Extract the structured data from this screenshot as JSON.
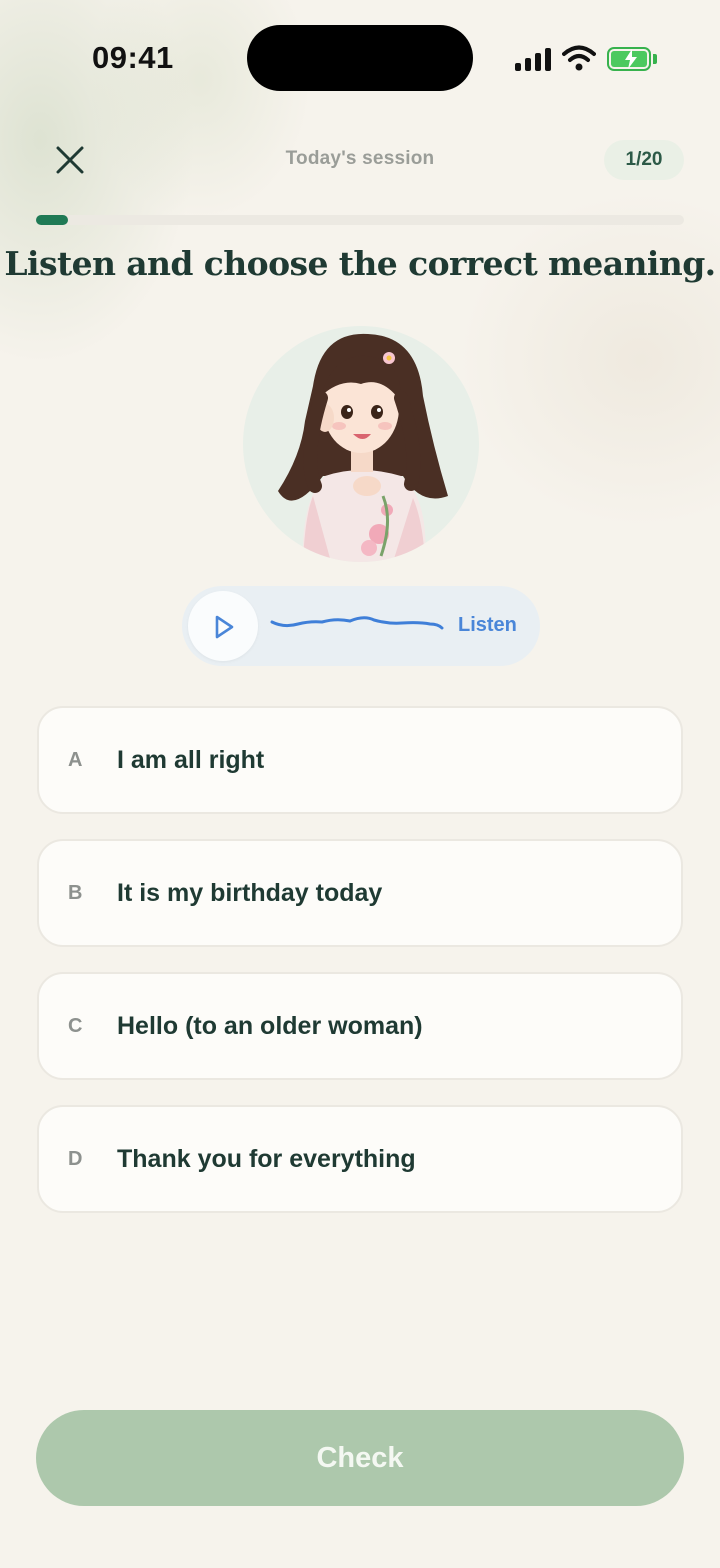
{
  "status_bar": {
    "time": "09:41",
    "icons": [
      "cellular-signal-icon",
      "wifi-icon",
      "battery-charging-icon"
    ]
  },
  "header": {
    "close_icon": "close-icon",
    "title": "Today's session",
    "counter": "1/20",
    "progress_fraction": 0.05
  },
  "question": {
    "prompt": "Listen and choose the correct meaning."
  },
  "audio": {
    "play_icon": "play-icon",
    "label": "Listen"
  },
  "options": [
    {
      "letter": "A",
      "text": "I am all right"
    },
    {
      "letter": "B",
      "text": "It is my birthday today"
    },
    {
      "letter": "C",
      "text": "Hello (to an older woman)"
    },
    {
      "letter": "D",
      "text": "Thank you for everything"
    }
  ],
  "footer": {
    "check_label": "Check"
  },
  "colors": {
    "accent_green": "#1f7a55",
    "check_button": "#adc8ac",
    "listen_blue": "#4a86d8",
    "background": "#f6f3ec"
  }
}
